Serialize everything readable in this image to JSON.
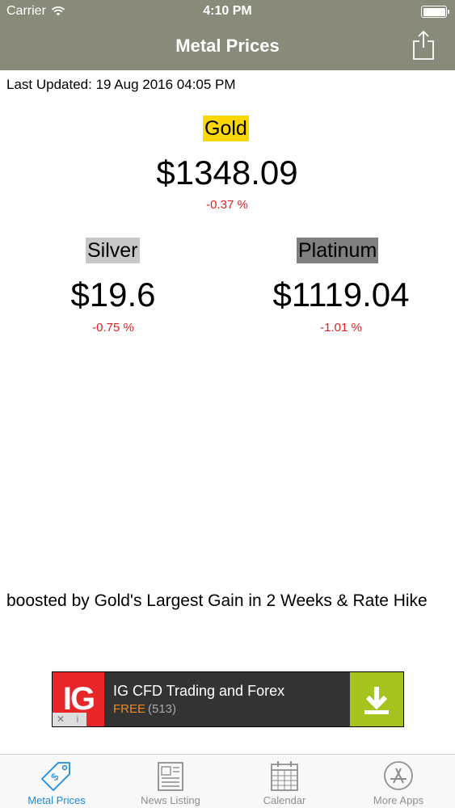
{
  "status_bar": {
    "carrier": "Carrier",
    "time": "4:10 PM",
    "battery_level": 1.0
  },
  "nav": {
    "title": "Metal Prices",
    "share_icon": "share-icon"
  },
  "last_updated": "Last Updated: 19 Aug 2016 04:05 PM",
  "metals": {
    "gold": {
      "name": "Gold",
      "price": "$1348.09",
      "change": "-0.37 %",
      "highlight": "#ffd700"
    },
    "silver": {
      "name": "Silver",
      "price": "$19.6",
      "change": "-0.75 %",
      "highlight": "#c8c8c8"
    },
    "platinum": {
      "name": "Platinum",
      "price": "$1119.04",
      "change": "-1.01 %",
      "highlight": "#808080"
    }
  },
  "ticker": {
    "text": "boosted by Gold's Largest Gain in 2 Weeks & Rate Hike"
  },
  "ad": {
    "logo": "IG",
    "title": "IG CFD Trading and Forex",
    "free_label": "FREE",
    "rating_count": "(513)",
    "close_label": "✕",
    "info_label": "i"
  },
  "tabs": [
    {
      "label": "Metal Prices",
      "icon": "price-tag-icon",
      "active": true
    },
    {
      "label": "News Listing",
      "icon": "newspaper-icon",
      "active": false
    },
    {
      "label": "Calendar",
      "icon": "calendar-icon",
      "active": false
    },
    {
      "label": "More Apps",
      "icon": "app-store-icon",
      "active": false
    }
  ],
  "colors": {
    "nav_background": "#8a8a7a",
    "change_negative": "#e02020",
    "active_tab": "#1a8be0",
    "ad_download": "#a5c420"
  }
}
